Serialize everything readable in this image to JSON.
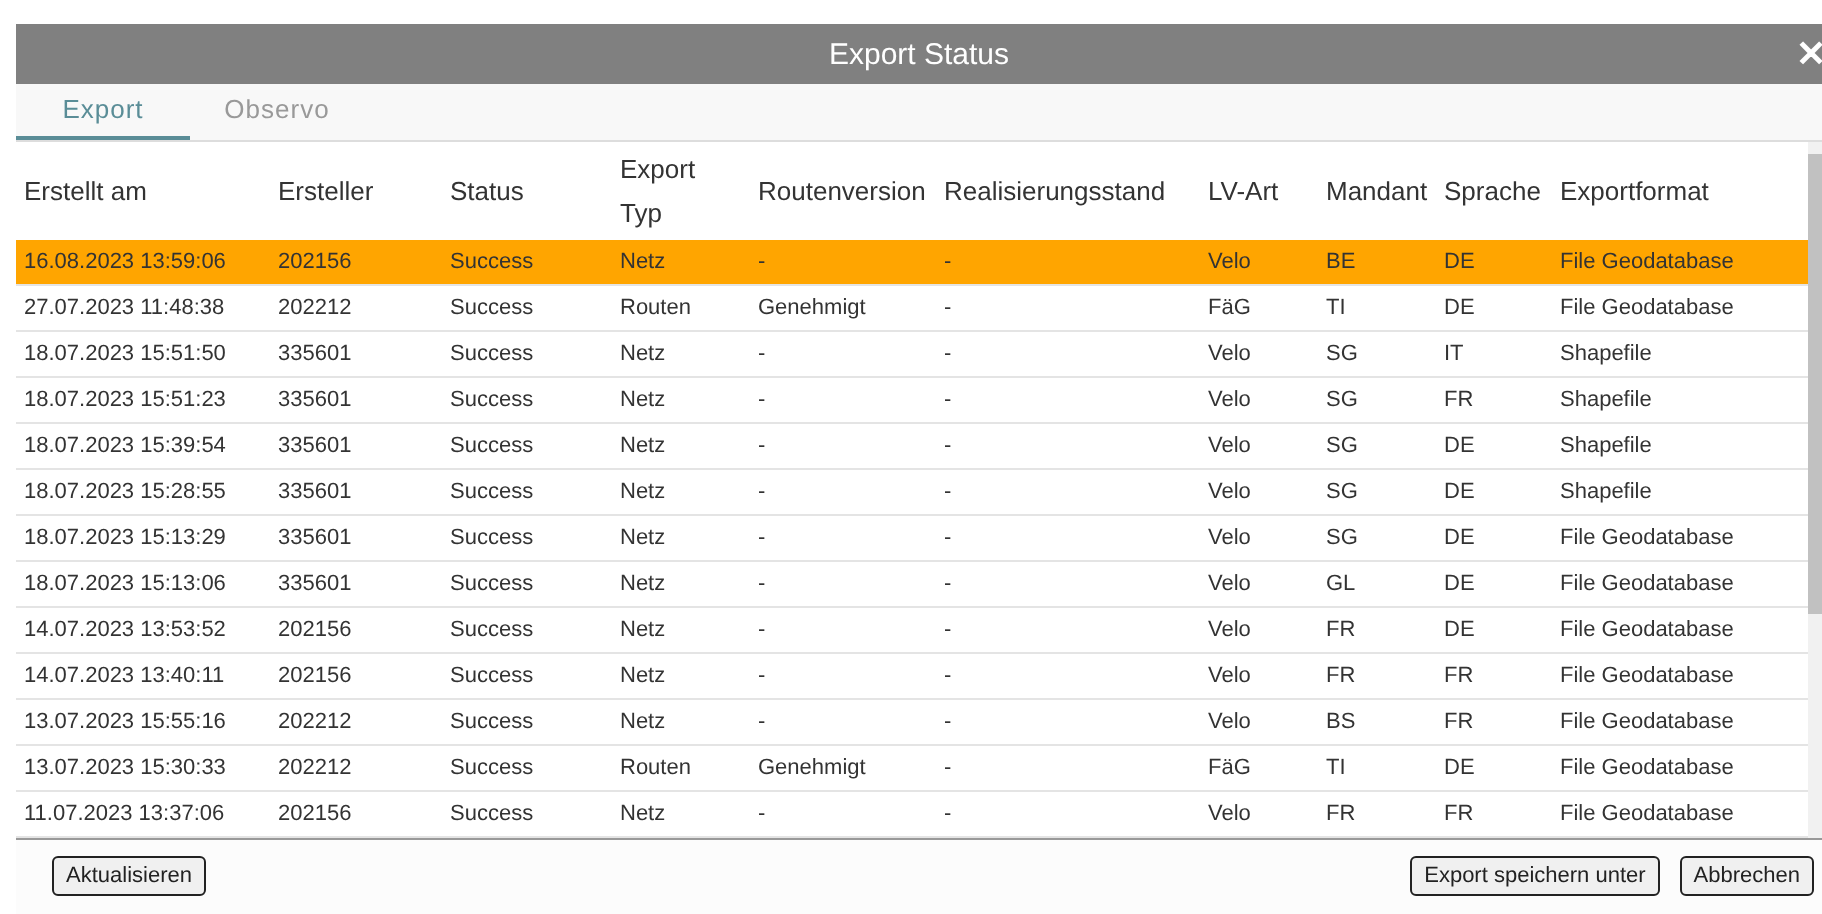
{
  "window": {
    "title": "Export Status",
    "close": "✕"
  },
  "tabs": [
    {
      "label": "Export",
      "selected": true
    },
    {
      "label": "Observo",
      "selected": false
    }
  ],
  "table": {
    "columns": [
      "Erstellt am",
      "Ersteller",
      "Status",
      "Export Typ",
      "Routenversion",
      "Realisierungsstand",
      "LV-Art",
      "Mandant",
      "Sprache",
      "Exportformat"
    ],
    "rows": [
      {
        "selected": true,
        "cells": [
          "16.08.2023 13:59:06",
          "202156",
          "Success",
          "Netz",
          "-",
          "-",
          "Velo",
          "BE",
          "DE",
          "File Geodatabase"
        ]
      },
      {
        "selected": false,
        "cells": [
          "27.07.2023 11:48:38",
          "202212",
          "Success",
          "Routen",
          "Genehmigt",
          "-",
          "FäG",
          "TI",
          "DE",
          "File Geodatabase"
        ]
      },
      {
        "selected": false,
        "cells": [
          "18.07.2023 15:51:50",
          "335601",
          "Success",
          "Netz",
          "-",
          "-",
          "Velo",
          "SG",
          "IT",
          "Shapefile"
        ]
      },
      {
        "selected": false,
        "cells": [
          "18.07.2023 15:51:23",
          "335601",
          "Success",
          "Netz",
          "-",
          "-",
          "Velo",
          "SG",
          "FR",
          "Shapefile"
        ]
      },
      {
        "selected": false,
        "cells": [
          "18.07.2023 15:39:54",
          "335601",
          "Success",
          "Netz",
          "-",
          "-",
          "Velo",
          "SG",
          "DE",
          "Shapefile"
        ]
      },
      {
        "selected": false,
        "cells": [
          "18.07.2023 15:28:55",
          "335601",
          "Success",
          "Netz",
          "-",
          "-",
          "Velo",
          "SG",
          "DE",
          "Shapefile"
        ]
      },
      {
        "selected": false,
        "cells": [
          "18.07.2023 15:13:29",
          "335601",
          "Success",
          "Netz",
          "-",
          "-",
          "Velo",
          "SG",
          "DE",
          "File Geodatabase"
        ]
      },
      {
        "selected": false,
        "cells": [
          "18.07.2023 15:13:06",
          "335601",
          "Success",
          "Netz",
          "-",
          "-",
          "Velo",
          "GL",
          "DE",
          "File Geodatabase"
        ]
      },
      {
        "selected": false,
        "cells": [
          "14.07.2023 13:53:52",
          "202156",
          "Success",
          "Netz",
          "-",
          "-",
          "Velo",
          "FR",
          "DE",
          "File Geodatabase"
        ]
      },
      {
        "selected": false,
        "cells": [
          "14.07.2023 13:40:11",
          "202156",
          "Success",
          "Netz",
          "-",
          "-",
          "Velo",
          "FR",
          "FR",
          "File Geodatabase"
        ]
      },
      {
        "selected": false,
        "cells": [
          "13.07.2023 15:55:16",
          "202212",
          "Success",
          "Netz",
          "-",
          "-",
          "Velo",
          "BS",
          "FR",
          "File Geodatabase"
        ]
      },
      {
        "selected": false,
        "cells": [
          "13.07.2023 15:30:33",
          "202212",
          "Success",
          "Routen",
          "Genehmigt",
          "-",
          "FäG",
          "TI",
          "DE",
          "File Geodatabase"
        ]
      },
      {
        "selected": false,
        "cells": [
          "11.07.2023 13:37:06",
          "202156",
          "Success",
          "Netz",
          "-",
          "-",
          "Velo",
          "FR",
          "FR",
          "File Geodatabase"
        ]
      }
    ]
  },
  "footer": {
    "left_buttons": [
      "Aktualisieren"
    ],
    "right_buttons": [
      "Export speichern unter",
      "Abbrechen"
    ]
  }
}
